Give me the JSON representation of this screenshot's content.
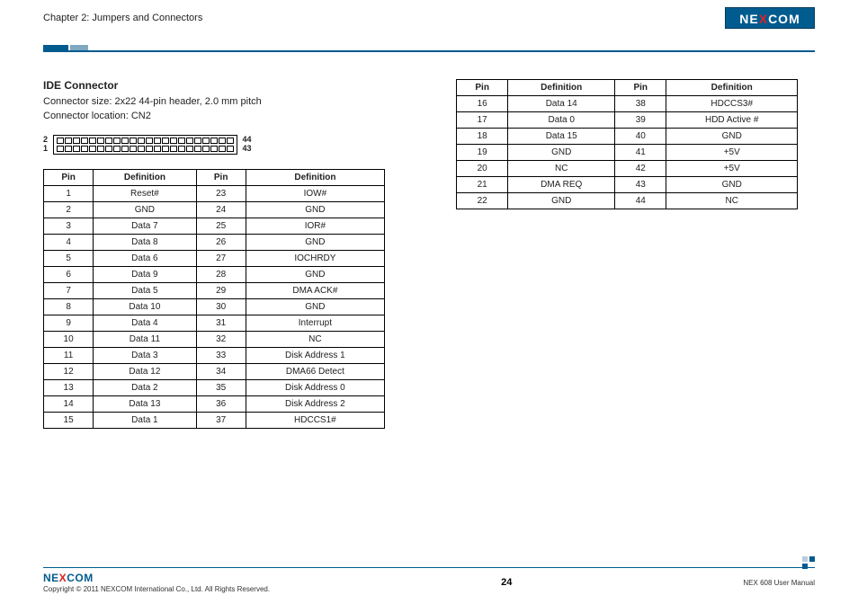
{
  "header": {
    "chapter": "Chapter 2: Jumpers and Connectors",
    "logo_text_pre": "NE",
    "logo_text_x": "X",
    "logo_text_post": "COM"
  },
  "section": {
    "title": "IDE Connector",
    "size_line": "Connector size: 2x22 44-pin header, 2.0 mm pitch",
    "location_line": "Connector location: CN2"
  },
  "connector_labels": {
    "left_top": "2",
    "left_bottom": "1",
    "right_top": "44",
    "right_bottom": "43"
  },
  "table_headers": {
    "pin": "Pin",
    "definition": "Definition"
  },
  "pins_left": [
    {
      "pin": "1",
      "def": "Reset#",
      "pin2": "23",
      "def2": "IOW#"
    },
    {
      "pin": "2",
      "def": "GND",
      "pin2": "24",
      "def2": "GND"
    },
    {
      "pin": "3",
      "def": "Data 7",
      "pin2": "25",
      "def2": "IOR#"
    },
    {
      "pin": "4",
      "def": "Data 8",
      "pin2": "26",
      "def2": "GND"
    },
    {
      "pin": "5",
      "def": "Data 6",
      "pin2": "27",
      "def2": "IOCHRDY"
    },
    {
      "pin": "6",
      "def": "Data 9",
      "pin2": "28",
      "def2": "GND"
    },
    {
      "pin": "7",
      "def": "Data 5",
      "pin2": "29",
      "def2": "DMA ACK#"
    },
    {
      "pin": "8",
      "def": "Data 10",
      "pin2": "30",
      "def2": "GND"
    },
    {
      "pin": "9",
      "def": "Data 4",
      "pin2": "31",
      "def2": "Interrupt"
    },
    {
      "pin": "10",
      "def": "Data 11",
      "pin2": "32",
      "def2": "NC"
    },
    {
      "pin": "11",
      "def": "Data 3",
      "pin2": "33",
      "def2": "Disk Address 1"
    },
    {
      "pin": "12",
      "def": "Data 12",
      "pin2": "34",
      "def2": "DMA66 Detect"
    },
    {
      "pin": "13",
      "def": "Data 2",
      "pin2": "35",
      "def2": "Disk Address 0"
    },
    {
      "pin": "14",
      "def": "Data 13",
      "pin2": "36",
      "def2": "Disk Address 2"
    },
    {
      "pin": "15",
      "def": "Data 1",
      "pin2": "37",
      "def2": "HDCCS1#"
    }
  ],
  "pins_right": [
    {
      "pin": "16",
      "def": "Data 14",
      "pin2": "38",
      "def2": "HDCCS3#"
    },
    {
      "pin": "17",
      "def": "Data 0",
      "pin2": "39",
      "def2": "HDD Active #"
    },
    {
      "pin": "18",
      "def": "Data 15",
      "pin2": "40",
      "def2": "GND"
    },
    {
      "pin": "19",
      "def": "GND",
      "pin2": "41",
      "def2": "+5V"
    },
    {
      "pin": "20",
      "def": "NC",
      "pin2": "42",
      "def2": "+5V"
    },
    {
      "pin": "21",
      "def": "DMA REQ",
      "pin2": "43",
      "def2": "GND"
    },
    {
      "pin": "22",
      "def": "GND",
      "pin2": "44",
      "def2": "NC"
    }
  ],
  "footer": {
    "copyright": "Copyright © 2011 NEXCOM International Co., Ltd. All Rights Reserved.",
    "page": "24",
    "manual": "NEX 608 User Manual"
  }
}
